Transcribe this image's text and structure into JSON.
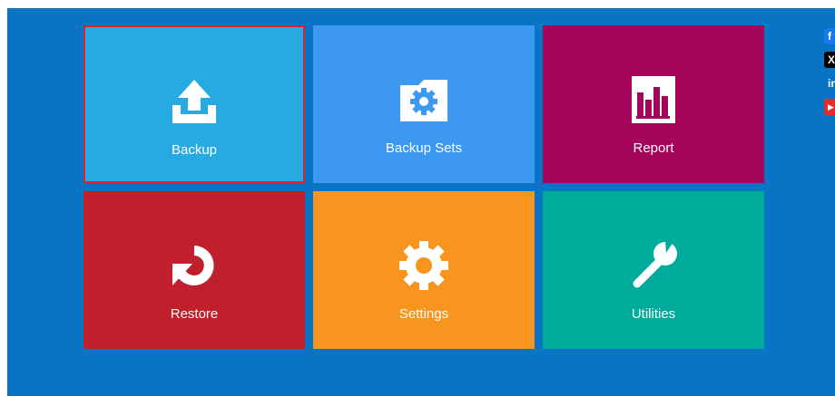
{
  "colors": {
    "background": "#0a74c4",
    "backup": "#27aae2",
    "backup_sets": "#3c98f0",
    "report": "#a4045a",
    "restore": "#c01f2c",
    "settings": "#f7951f",
    "utilities": "#00ab9c",
    "selected_border": "#d7262b"
  },
  "tiles": [
    {
      "label": "Backup",
      "icon": "upload-icon",
      "selected": true
    },
    {
      "label": "Backup Sets",
      "icon": "folder-gear-icon"
    },
    {
      "label": "Report",
      "icon": "bar-chart-icon"
    },
    {
      "label": "Restore",
      "icon": "restore-arrow-icon"
    },
    {
      "label": "Settings",
      "icon": "gear-icon"
    },
    {
      "label": "Utilities",
      "icon": "wrench-icon"
    }
  ],
  "social": [
    {
      "name": "facebook-icon",
      "glyph": "f"
    },
    {
      "name": "x-icon",
      "glyph": "X"
    },
    {
      "name": "linkedin-icon",
      "glyph": "in"
    },
    {
      "name": "youtube-icon",
      "glyph": "▶"
    }
  ]
}
